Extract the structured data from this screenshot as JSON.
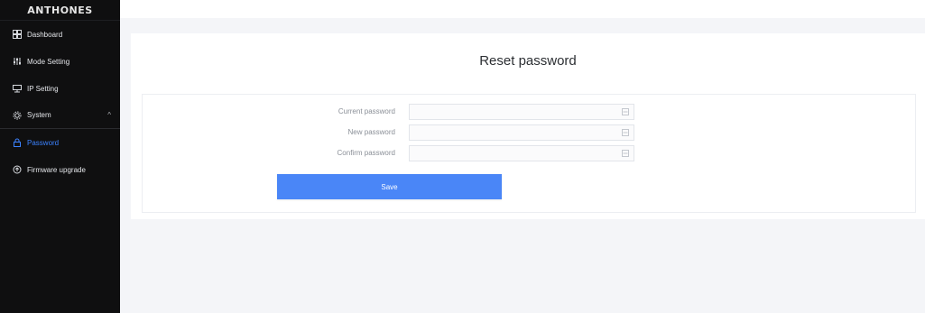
{
  "app": {
    "brand": "ANTHONES"
  },
  "sidebar": {
    "items": [
      {
        "label": "Dashboard",
        "icon": "grid-icon"
      },
      {
        "label": "Mode Setting",
        "icon": "sliders-icon"
      },
      {
        "label": "IP Setting",
        "icon": "network-icon"
      },
      {
        "label": "System",
        "icon": "gear-icon",
        "chevron": "^"
      },
      {
        "label": "Password",
        "icon": "lock-icon",
        "active": true
      },
      {
        "label": "Firmware upgrade",
        "icon": "upgrade-icon"
      }
    ]
  },
  "main": {
    "title": "Reset password",
    "form": {
      "fields": [
        {
          "label": "Current password",
          "value": "",
          "placeholder": ""
        },
        {
          "label": "New password",
          "value": "",
          "placeholder": ""
        },
        {
          "label": "Confirm password",
          "value": "",
          "placeholder": ""
        }
      ],
      "save_label": "Save"
    }
  },
  "colors": {
    "sidebar_bg": "#0f0f10",
    "accent": "#4a86f7",
    "active_text": "#3b82ff",
    "page_bg": "#f4f5f8"
  }
}
